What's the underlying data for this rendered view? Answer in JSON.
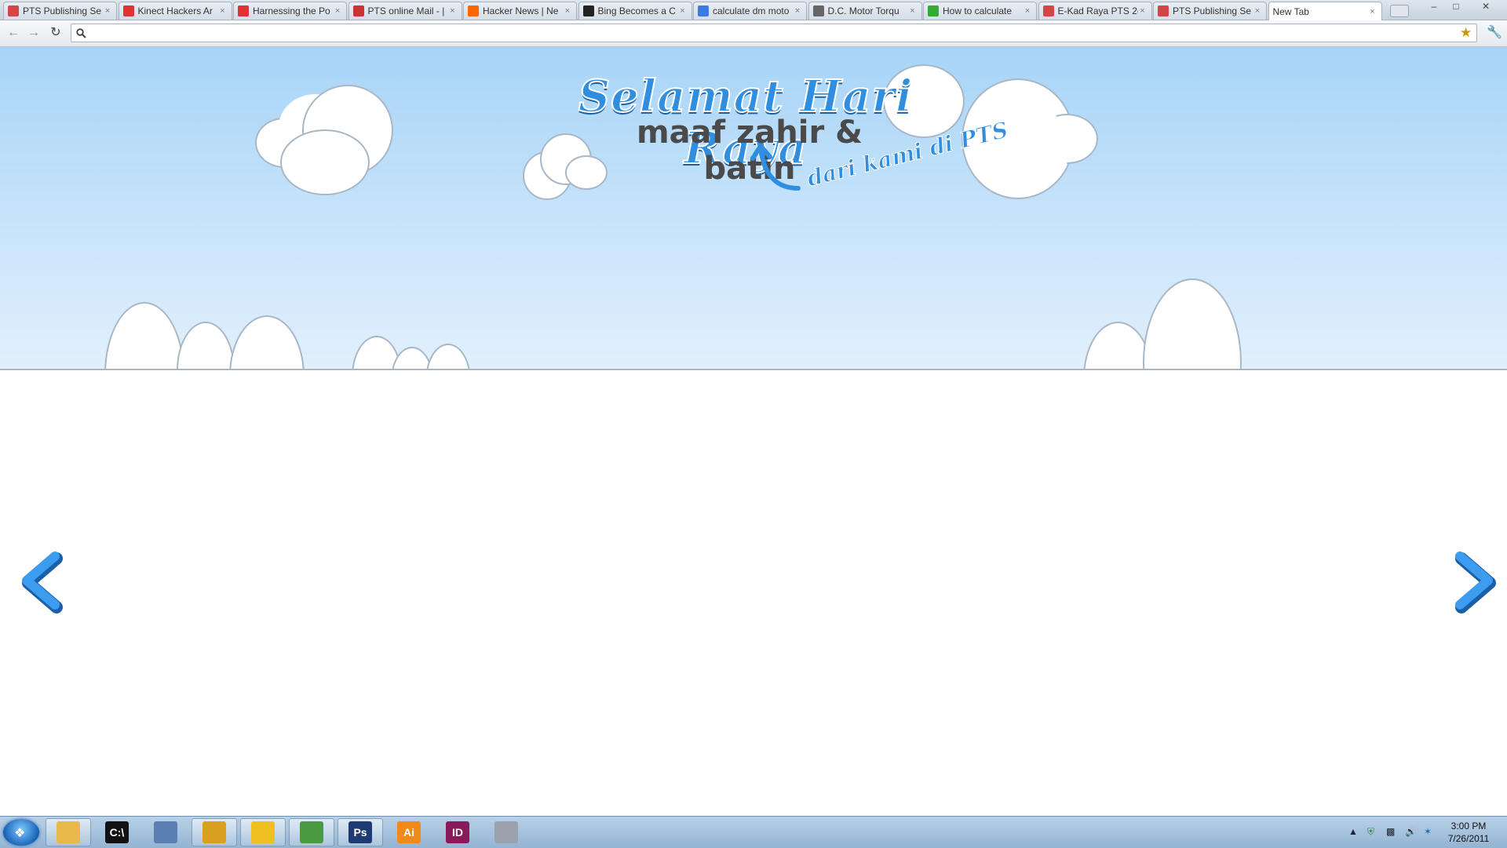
{
  "browser": {
    "tabs": [
      {
        "title": "PTS Publishing Se",
        "icon": "pdf-icon",
        "color": "#d64545"
      },
      {
        "title": "Kinect Hackers Ar",
        "icon": "instapaper-icon",
        "color": "#d33"
      },
      {
        "title": "Harnessing the Po",
        "icon": "instapaper-icon",
        "color": "#d33"
      },
      {
        "title": "PTS online Mail - |",
        "icon": "gmail-icon",
        "color": "#c33"
      },
      {
        "title": "Hacker News | Ne",
        "icon": "ycombinator-icon",
        "color": "#f60"
      },
      {
        "title": "Bing Becomes a C",
        "icon": "nyt-icon",
        "color": "#222"
      },
      {
        "title": "calculate dm moto",
        "icon": "google-icon",
        "color": "#3a7de0"
      },
      {
        "title": "D.C. Motor Torqu",
        "icon": "globe-icon",
        "color": "#666"
      },
      {
        "title": "How to calculate",
        "icon": "leaf-icon",
        "color": "#3a3"
      },
      {
        "title": "E-Kad Raya PTS 2(",
        "icon": "pdf-icon",
        "color": "#d64545"
      },
      {
        "title": "PTS Publishing Se",
        "icon": "pdf-icon",
        "color": "#d64545"
      },
      {
        "title": "New Tab",
        "icon": "",
        "color": "#ffffff"
      }
    ],
    "close_glyph": "×",
    "omnibox": {
      "value": "",
      "placeholder": ""
    }
  },
  "page": {
    "heading": "Selamat Hari Raya",
    "subheading": "maaf zahir & batin",
    "byline": "dari kami di PTS",
    "sky_color": "#a7d4f7",
    "accent_color": "#2f8ee0"
  },
  "taskbar": {
    "apps": [
      {
        "name": "explorer",
        "label": "",
        "color": "#e8b84a",
        "open": true
      },
      {
        "name": "cmd",
        "label": "C:\\",
        "color": "#111111",
        "open": false
      },
      {
        "name": "virtualbox",
        "label": "",
        "color": "#5a7fb0",
        "open": false
      },
      {
        "name": "chrome",
        "label": "",
        "color": "#d9a020",
        "open": true
      },
      {
        "name": "cyberduck",
        "label": "",
        "color": "#f0c020",
        "open": true
      },
      {
        "name": "notepad",
        "label": "",
        "color": "#4a9a40",
        "open": true
      },
      {
        "name": "photoshop",
        "label": "Ps",
        "color": "#1e3a72",
        "open": true
      },
      {
        "name": "illustrator",
        "label": "Ai",
        "color": "#f08a1a",
        "open": false
      },
      {
        "name": "indesign",
        "label": "ID",
        "color": "#8a1a5a",
        "open": false
      },
      {
        "name": "network-tool",
        "label": "",
        "color": "#9aa3ad",
        "open": false
      }
    ],
    "clock_time": "3:00 PM",
    "clock_date": "7/26/2011"
  }
}
